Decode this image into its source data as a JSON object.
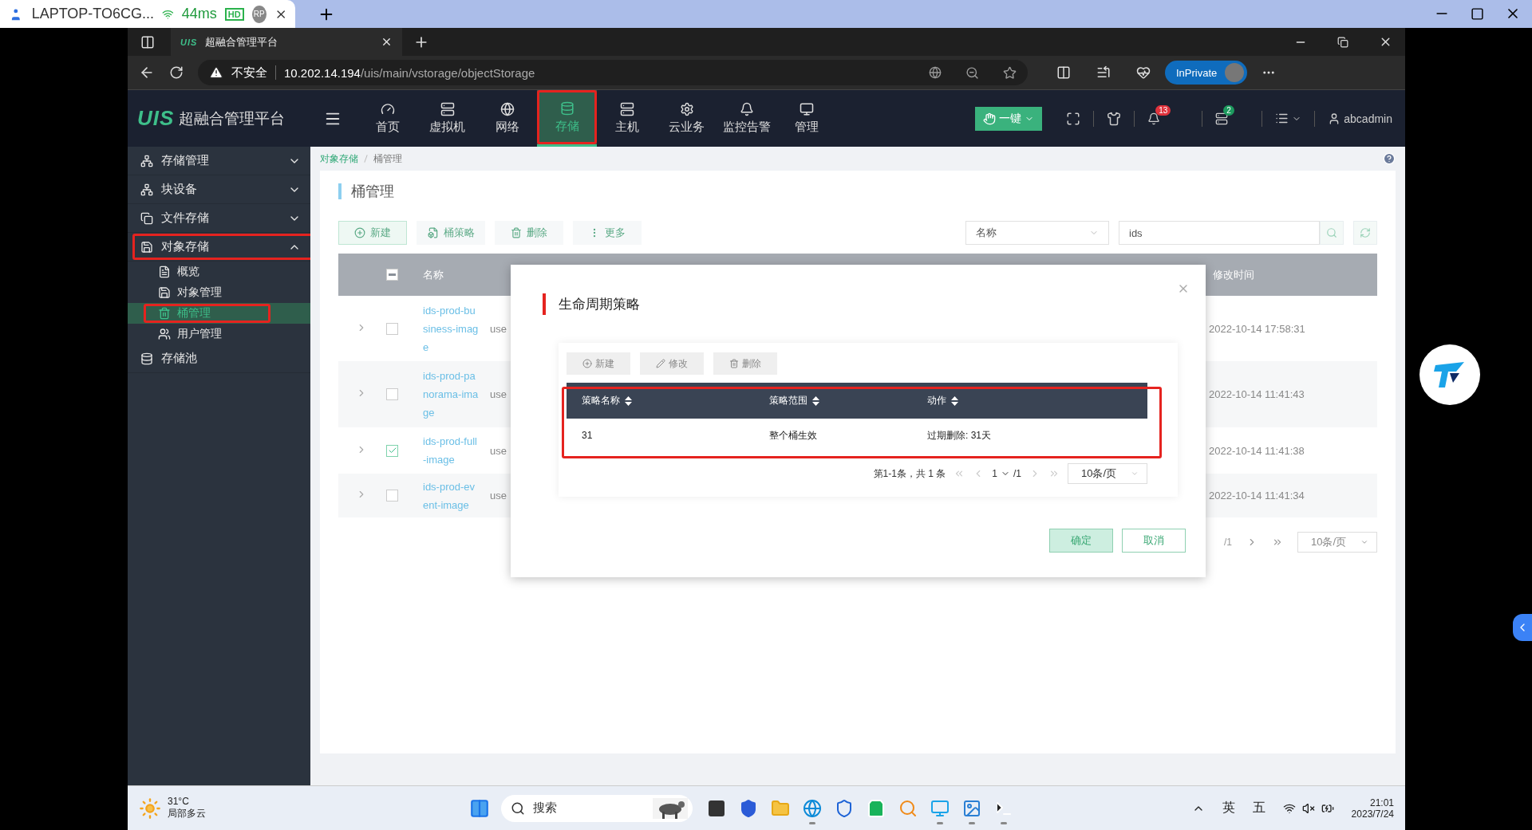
{
  "remote_session": {
    "title": "LAPTOP-TO6CG...",
    "latency": "44ms",
    "quality": "HD",
    "badge": "RP"
  },
  "browser": {
    "tab_logo": "UIS",
    "tab_title": "超融合管理平台",
    "security": "不安全",
    "url_host": "10.202.14.194",
    "url_path": "/uis/main/vstorage/objectStorage",
    "profile": "InPrivate"
  },
  "header": {
    "logo": "UIS",
    "title": "超融合管理平台",
    "quick_button": "一键",
    "alerts": "13",
    "tasks": "2",
    "user": "abcadmin",
    "nav": [
      {
        "label": "首页",
        "kind": "gauge",
        "selected": false,
        "annotated": false
      },
      {
        "label": "虚拟机",
        "kind": "vm",
        "selected": false,
        "annotated": false
      },
      {
        "label": "网络",
        "kind": "globe",
        "selected": false,
        "annotated": false
      },
      {
        "label": "存储",
        "kind": "storage",
        "selected": true,
        "annotated": true
      },
      {
        "label": "主机",
        "kind": "host",
        "selected": false,
        "annotated": false
      },
      {
        "label": "云业务",
        "kind": "gear",
        "selected": false,
        "annotated": false
      },
      {
        "label": "监控告警",
        "kind": "bell",
        "selected": false,
        "annotated": false
      },
      {
        "label": "管理",
        "kind": "monitor",
        "selected": false,
        "annotated": false
      }
    ]
  },
  "sidebar": {
    "items": [
      {
        "label": "存储管理",
        "kind": "group",
        "expanded": false,
        "annotated": false
      },
      {
        "label": "块设备",
        "kind": "group",
        "expanded": false,
        "annotated": false
      },
      {
        "label": "文件存储",
        "kind": "group",
        "expanded": false,
        "annotated": false
      },
      {
        "label": "对象存储",
        "kind": "group",
        "expanded": true,
        "annotated": true,
        "children": [
          {
            "label": "概览",
            "selected": false,
            "annotated": false
          },
          {
            "label": "对象管理",
            "selected": false,
            "annotated": false
          },
          {
            "label": "桶管理",
            "selected": true,
            "annotated": true
          },
          {
            "label": "用户管理",
            "selected": false,
            "annotated": false
          }
        ]
      },
      {
        "label": "存储池",
        "kind": "leaf"
      }
    ]
  },
  "breadcrumb": [
    "对象存储",
    "桶管理"
  ],
  "page_title": "桶管理",
  "toolbar": [
    {
      "label": "新建",
      "kind": "add"
    },
    {
      "label": "桶策略",
      "kind": "policy"
    },
    {
      "label": "删除",
      "kind": "delete"
    },
    {
      "label": "更多",
      "kind": "more"
    }
  ],
  "filter": {
    "field": "名称",
    "value": "ids"
  },
  "table": {
    "columns": [
      "名称",
      "修改时间"
    ],
    "select_all_partial": true,
    "rows": [
      {
        "name": "ids-prod-business-image",
        "owner": "use",
        "checked": false,
        "modified": "2022-10-14 17:58:31"
      },
      {
        "name": "ids-prod-panorama-image",
        "owner": "use",
        "checked": false,
        "modified": "2022-10-14 11:41:43"
      },
      {
        "name": "ids-prod-full-image",
        "owner": "use",
        "checked": true,
        "modified": "2022-10-14 11:41:38"
      },
      {
        "name": "ids-prod-event-image",
        "owner": "use",
        "checked": false,
        "modified": "2022-10-14 11:41:34"
      }
    ]
  },
  "pagination": {
    "pages": "/1",
    "page_size": "10条/页"
  },
  "modal": {
    "title": "生命周期策略",
    "annotated": true,
    "toolbar": [
      {
        "label": "新建",
        "kind": "add"
      },
      {
        "label": "修改",
        "kind": "edit"
      },
      {
        "label": "删除",
        "kind": "delete"
      }
    ],
    "columns": [
      "策略名称",
      "策略范围",
      "动作"
    ],
    "rows": [
      [
        "31",
        "整个桶生效",
        "过期删除: 31天"
      ]
    ],
    "pagination": {
      "summary": "第1-1条，共 1 条",
      "page": "1",
      "pages": "/1",
      "page_size": "10条/页"
    },
    "buttons": [
      {
        "label": "确定",
        "kind": "primary"
      },
      {
        "label": "取消",
        "kind": "secondary"
      }
    ]
  },
  "taskbar": {
    "temperature": "31°C",
    "weather": "局部多云",
    "search_placeholder": "搜索",
    "apps": [
      {
        "kind": "files",
        "running": false
      },
      {
        "kind": "visio",
        "running": false
      },
      {
        "kind": "folder",
        "running": false
      },
      {
        "kind": "edge",
        "running": true
      },
      {
        "kind": "shield",
        "running": false
      },
      {
        "kind": "bag",
        "running": false
      },
      {
        "kind": "search",
        "running": false
      },
      {
        "kind": "bird",
        "running": true
      },
      {
        "kind": "remote",
        "running": true
      },
      {
        "kind": "terminal",
        "running": true
      }
    ],
    "ime_lang": "英",
    "ime_mode": "五",
    "time": "21:01",
    "date": "2023/7/24"
  }
}
